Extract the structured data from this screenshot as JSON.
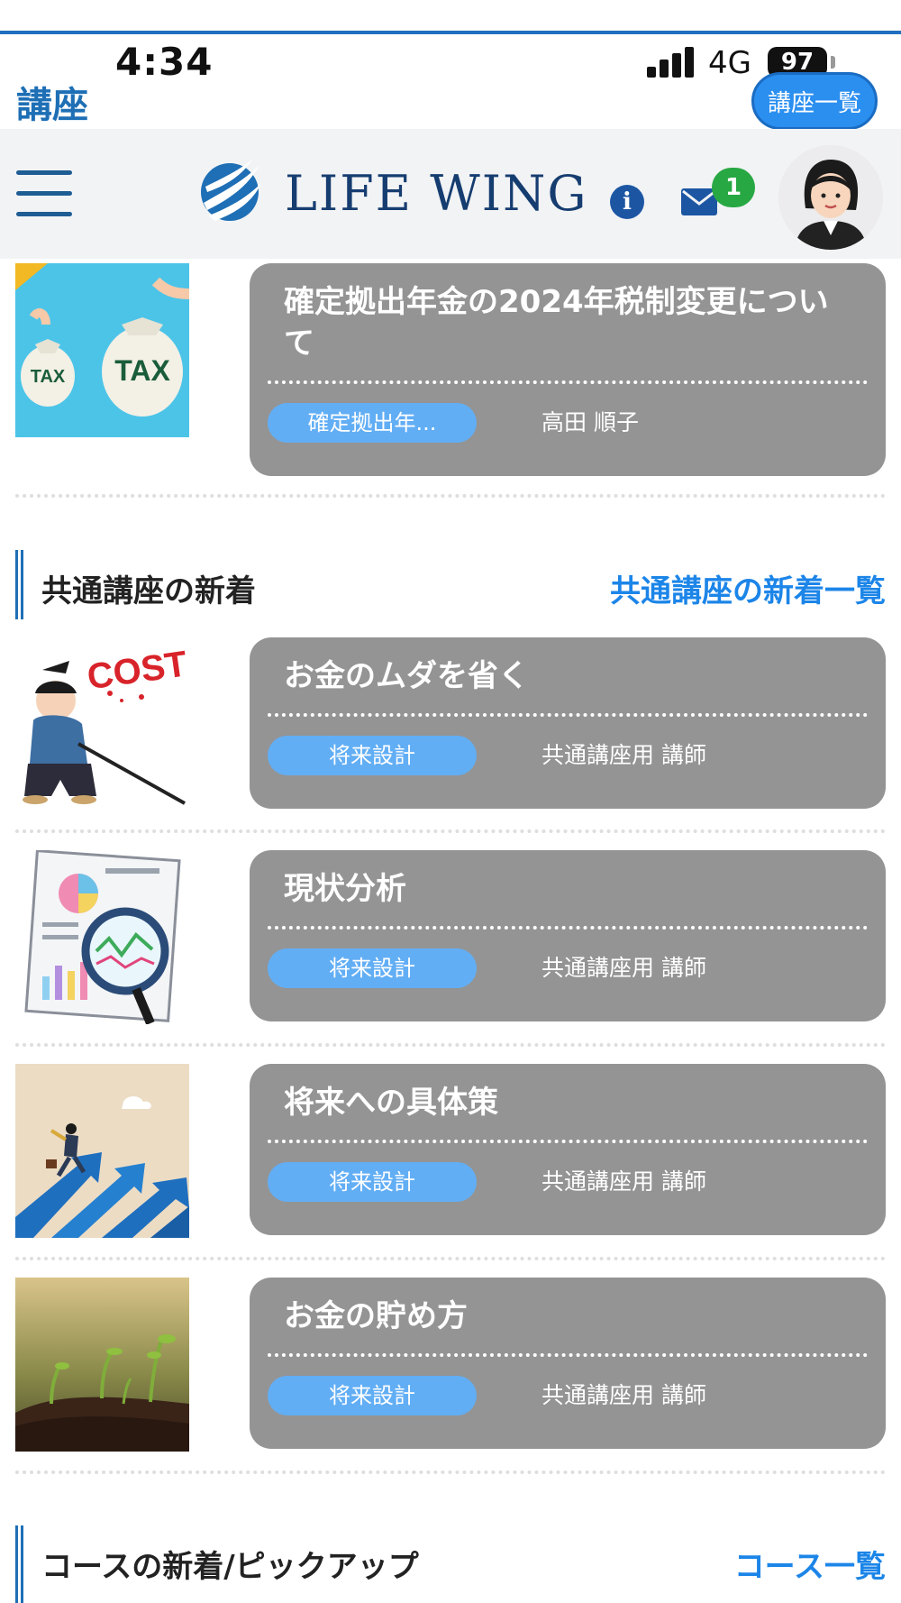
{
  "status_bar": {
    "time": "4:34",
    "network": "4G",
    "battery": "97"
  },
  "page": {
    "heading": "講座",
    "list_button": "講座一覧"
  },
  "header": {
    "logo_text": "LIFE WING",
    "mail_badge": "1"
  },
  "top_item": {
    "title": "確定拠出年金の2024年税制変更について",
    "tag": "確定拠出年...",
    "author": "高田 順子",
    "thumb_labels": [
      "TAX",
      "TAX"
    ]
  },
  "common_section": {
    "title": "共通講座の新着",
    "link": "共通講座の新着一覧",
    "items": [
      {
        "title": "お金のムダを省く",
        "tag": "将来設計",
        "author": "共通講座用 講師",
        "thumb_label": "COST"
      },
      {
        "title": "現状分析",
        "tag": "将来設計",
        "author": "共通講座用 講師"
      },
      {
        "title": "将来への具体策",
        "tag": "将来設計",
        "author": "共通講座用 講師"
      },
      {
        "title": "お金の貯め方",
        "tag": "将来設計",
        "author": "共通講座用 講師"
      }
    ]
  },
  "course_section": {
    "title": "コースの新着/ピックアップ",
    "link": "コース一覧"
  },
  "colors": {
    "accent": "#1e6fb5",
    "link": "#1c85e8",
    "card": "#949494",
    "tag": "#62aef5",
    "badge": "#27a843"
  }
}
